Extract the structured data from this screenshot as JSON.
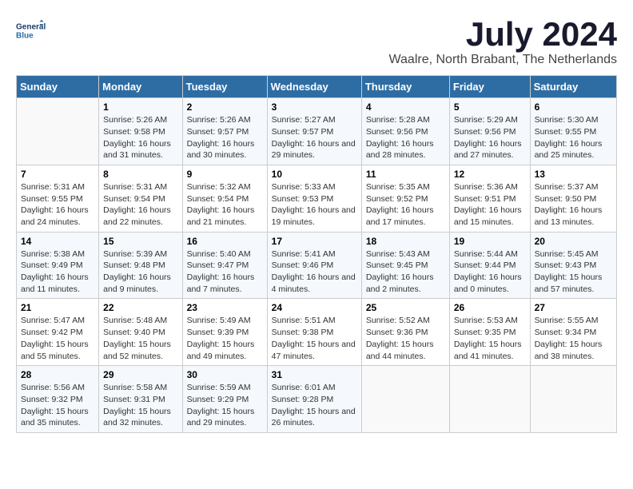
{
  "logo": {
    "line1": "General",
    "line2": "Blue"
  },
  "title": "July 2024",
  "location": "Waalre, North Brabant, The Netherlands",
  "weekdays": [
    "Sunday",
    "Monday",
    "Tuesday",
    "Wednesday",
    "Thursday",
    "Friday",
    "Saturday"
  ],
  "weeks": [
    [
      {
        "day": "",
        "sunrise": "",
        "sunset": "",
        "daylight": ""
      },
      {
        "day": "1",
        "sunrise": "Sunrise: 5:26 AM",
        "sunset": "Sunset: 9:58 PM",
        "daylight": "Daylight: 16 hours and 31 minutes."
      },
      {
        "day": "2",
        "sunrise": "Sunrise: 5:26 AM",
        "sunset": "Sunset: 9:57 PM",
        "daylight": "Daylight: 16 hours and 30 minutes."
      },
      {
        "day": "3",
        "sunrise": "Sunrise: 5:27 AM",
        "sunset": "Sunset: 9:57 PM",
        "daylight": "Daylight: 16 hours and 29 minutes."
      },
      {
        "day": "4",
        "sunrise": "Sunrise: 5:28 AM",
        "sunset": "Sunset: 9:56 PM",
        "daylight": "Daylight: 16 hours and 28 minutes."
      },
      {
        "day": "5",
        "sunrise": "Sunrise: 5:29 AM",
        "sunset": "Sunset: 9:56 PM",
        "daylight": "Daylight: 16 hours and 27 minutes."
      },
      {
        "day": "6",
        "sunrise": "Sunrise: 5:30 AM",
        "sunset": "Sunset: 9:55 PM",
        "daylight": "Daylight: 16 hours and 25 minutes."
      }
    ],
    [
      {
        "day": "7",
        "sunrise": "Sunrise: 5:31 AM",
        "sunset": "Sunset: 9:55 PM",
        "daylight": "Daylight: 16 hours and 24 minutes."
      },
      {
        "day": "8",
        "sunrise": "Sunrise: 5:31 AM",
        "sunset": "Sunset: 9:54 PM",
        "daylight": "Daylight: 16 hours and 22 minutes."
      },
      {
        "day": "9",
        "sunrise": "Sunrise: 5:32 AM",
        "sunset": "Sunset: 9:54 PM",
        "daylight": "Daylight: 16 hours and 21 minutes."
      },
      {
        "day": "10",
        "sunrise": "Sunrise: 5:33 AM",
        "sunset": "Sunset: 9:53 PM",
        "daylight": "Daylight: 16 hours and 19 minutes."
      },
      {
        "day": "11",
        "sunrise": "Sunrise: 5:35 AM",
        "sunset": "Sunset: 9:52 PM",
        "daylight": "Daylight: 16 hours and 17 minutes."
      },
      {
        "day": "12",
        "sunrise": "Sunrise: 5:36 AM",
        "sunset": "Sunset: 9:51 PM",
        "daylight": "Daylight: 16 hours and 15 minutes."
      },
      {
        "day": "13",
        "sunrise": "Sunrise: 5:37 AM",
        "sunset": "Sunset: 9:50 PM",
        "daylight": "Daylight: 16 hours and 13 minutes."
      }
    ],
    [
      {
        "day": "14",
        "sunrise": "Sunrise: 5:38 AM",
        "sunset": "Sunset: 9:49 PM",
        "daylight": "Daylight: 16 hours and 11 minutes."
      },
      {
        "day": "15",
        "sunrise": "Sunrise: 5:39 AM",
        "sunset": "Sunset: 9:48 PM",
        "daylight": "Daylight: 16 hours and 9 minutes."
      },
      {
        "day": "16",
        "sunrise": "Sunrise: 5:40 AM",
        "sunset": "Sunset: 9:47 PM",
        "daylight": "Daylight: 16 hours and 7 minutes."
      },
      {
        "day": "17",
        "sunrise": "Sunrise: 5:41 AM",
        "sunset": "Sunset: 9:46 PM",
        "daylight": "Daylight: 16 hours and 4 minutes."
      },
      {
        "day": "18",
        "sunrise": "Sunrise: 5:43 AM",
        "sunset": "Sunset: 9:45 PM",
        "daylight": "Daylight: 16 hours and 2 minutes."
      },
      {
        "day": "19",
        "sunrise": "Sunrise: 5:44 AM",
        "sunset": "Sunset: 9:44 PM",
        "daylight": "Daylight: 16 hours and 0 minutes."
      },
      {
        "day": "20",
        "sunrise": "Sunrise: 5:45 AM",
        "sunset": "Sunset: 9:43 PM",
        "daylight": "Daylight: 15 hours and 57 minutes."
      }
    ],
    [
      {
        "day": "21",
        "sunrise": "Sunrise: 5:47 AM",
        "sunset": "Sunset: 9:42 PM",
        "daylight": "Daylight: 15 hours and 55 minutes."
      },
      {
        "day": "22",
        "sunrise": "Sunrise: 5:48 AM",
        "sunset": "Sunset: 9:40 PM",
        "daylight": "Daylight: 15 hours and 52 minutes."
      },
      {
        "day": "23",
        "sunrise": "Sunrise: 5:49 AM",
        "sunset": "Sunset: 9:39 PM",
        "daylight": "Daylight: 15 hours and 49 minutes."
      },
      {
        "day": "24",
        "sunrise": "Sunrise: 5:51 AM",
        "sunset": "Sunset: 9:38 PM",
        "daylight": "Daylight: 15 hours and 47 minutes."
      },
      {
        "day": "25",
        "sunrise": "Sunrise: 5:52 AM",
        "sunset": "Sunset: 9:36 PM",
        "daylight": "Daylight: 15 hours and 44 minutes."
      },
      {
        "day": "26",
        "sunrise": "Sunrise: 5:53 AM",
        "sunset": "Sunset: 9:35 PM",
        "daylight": "Daylight: 15 hours and 41 minutes."
      },
      {
        "day": "27",
        "sunrise": "Sunrise: 5:55 AM",
        "sunset": "Sunset: 9:34 PM",
        "daylight": "Daylight: 15 hours and 38 minutes."
      }
    ],
    [
      {
        "day": "28",
        "sunrise": "Sunrise: 5:56 AM",
        "sunset": "Sunset: 9:32 PM",
        "daylight": "Daylight: 15 hours and 35 minutes."
      },
      {
        "day": "29",
        "sunrise": "Sunrise: 5:58 AM",
        "sunset": "Sunset: 9:31 PM",
        "daylight": "Daylight: 15 hours and 32 minutes."
      },
      {
        "day": "30",
        "sunrise": "Sunrise: 5:59 AM",
        "sunset": "Sunset: 9:29 PM",
        "daylight": "Daylight: 15 hours and 29 minutes."
      },
      {
        "day": "31",
        "sunrise": "Sunrise: 6:01 AM",
        "sunset": "Sunset: 9:28 PM",
        "daylight": "Daylight: 15 hours and 26 minutes."
      },
      {
        "day": "",
        "sunrise": "",
        "sunset": "",
        "daylight": ""
      },
      {
        "day": "",
        "sunrise": "",
        "sunset": "",
        "daylight": ""
      },
      {
        "day": "",
        "sunrise": "",
        "sunset": "",
        "daylight": ""
      }
    ]
  ]
}
